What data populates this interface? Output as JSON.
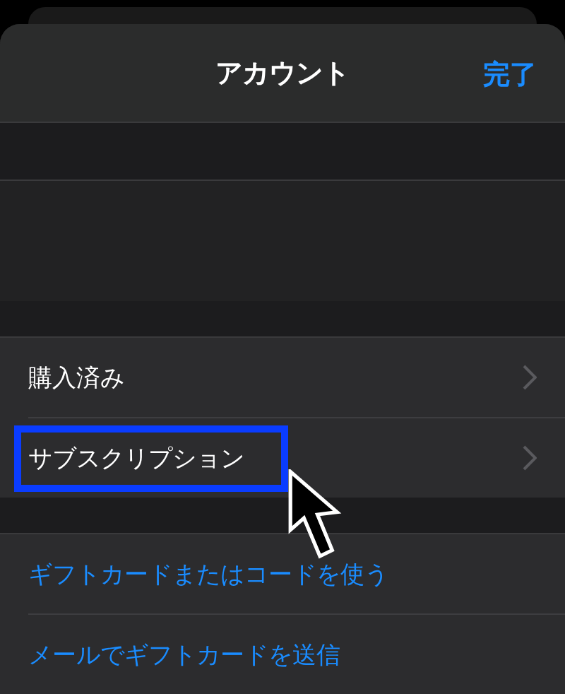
{
  "header": {
    "title": "アカウント",
    "done_button": "完了"
  },
  "groups": [
    {
      "rows": [
        {
          "label": "購入済み",
          "kind": "nav",
          "highlighted": false
        },
        {
          "label": "サブスクリプション",
          "kind": "nav",
          "highlighted": true
        }
      ]
    },
    {
      "rows": [
        {
          "label": "ギフトカードまたはコードを使う",
          "kind": "link",
          "highlighted": false
        },
        {
          "label": "メールでギフトカードを送信",
          "kind": "link",
          "highlighted": false
        }
      ]
    }
  ]
}
